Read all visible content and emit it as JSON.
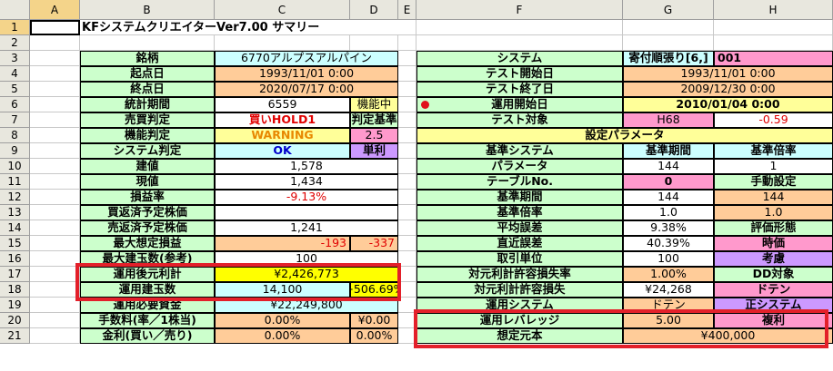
{
  "column_headers": [
    "A",
    "B",
    "C",
    "D",
    "E",
    "F",
    "G",
    "H"
  ],
  "title": "KFシステムクリエイターVer7.00  サマリー",
  "cells": {
    "B3": "銘柄",
    "C3": "6770アルプスアルパイン",
    "B4": "起点日",
    "C4": "1993/11/01 0:00",
    "B5": "終点日",
    "C5": "2020/07/17 0:00",
    "B6": "統計期間",
    "C6": "6559",
    "D6": "機能中",
    "B7": "売買判定",
    "C7": "買いHOLD1",
    "D7": "判定基準",
    "B8": "機能判定",
    "C8": "WARNING",
    "D8": "2.5",
    "B9": "システム判定",
    "C9": "OK",
    "D9": "単利",
    "B10": "建値",
    "C10": "1,578",
    "B11": "現値",
    "C11": "1,434",
    "B12": "損益率",
    "C12": "-9.13%",
    "B13": "買返済予定株価",
    "B14": "売返済予定株価",
    "C14": "1,241",
    "B15": "最大想定損益",
    "C15": "-193",
    "D15": "-337",
    "B16": "最大建玉数(参考)",
    "C16": "100",
    "B17": "運用後元利計",
    "C17": "¥2,426,773",
    "B18": "運用建玉数",
    "C18": "14,100",
    "D18": "+506.69%",
    "B19": "運用必要資金",
    "C19": "¥22,249,800",
    "B20": "手数料(率／1株当)",
    "C20": "0.00%",
    "D20": "¥0.00",
    "B21": "金利(買い／売り)",
    "C21": "0.00%",
    "D21": "0.00%",
    "F3": "システム",
    "G3": "寄付順張り[6,]",
    "H3": "001",
    "F4": "テスト開始日",
    "G4": "1993/11/01 0:00",
    "F5": "テスト終了日",
    "G5": "2009/12/30 0:00",
    "F6": "運用開始日",
    "G6": "2010/01/04 0:00",
    "F7": "テスト対象",
    "G7": "H68",
    "H7": "-0.59",
    "F8": "設定パラメータ",
    "F9": "基準システム",
    "G9": "基準期間",
    "H9": "基準倍率",
    "F10": "パラメータ",
    "G10": "144",
    "H10": "1",
    "F11": "テーブルNo.",
    "G11": "0",
    "H11": "手動設定",
    "F12": "基準期間",
    "G12": "144",
    "H12": "144",
    "F13": "基準倍率",
    "G13": "1.0",
    "H13": "1.0",
    "F14": "平均誤差",
    "G14": "9.38%",
    "H14": "評価形態",
    "F15": "直近誤差",
    "G15": "40.39%",
    "H15": "時価",
    "F16": "取引単位",
    "G16": "100",
    "H16": "考慮",
    "F17": "対元利計許容損失率",
    "G17": "1.00%",
    "H17": "DD対象",
    "F18": "対元利計許容損失",
    "G18": "¥24,268",
    "H18": "ドテン",
    "F19": "運用システム",
    "G19": "ドテン",
    "H19": "正システム",
    "F20": "運用レバレッジ",
    "G20": "5.00",
    "H20": "複利",
    "F21": "想定元本",
    "G21": "¥400,000"
  },
  "colors": {
    "green": "#ccffcc",
    "peach": "#ffcc99",
    "cyan": "#ccffff",
    "lightyellow": "#ffff99",
    "pink": "#ff99cc",
    "purple": "#cc99ff",
    "yellow": "#ffff00",
    "highlight": "#e3202a"
  }
}
